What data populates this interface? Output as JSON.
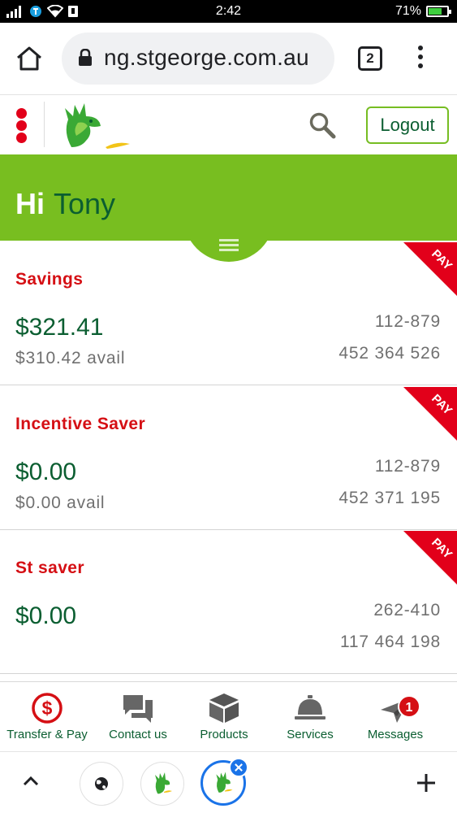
{
  "status_bar": {
    "time": "2:42",
    "battery": "71%",
    "battery_level": 0.71
  },
  "browser": {
    "url": "ng.stgeorge.com.au",
    "tab_count": "2"
  },
  "header": {
    "logout_label": "Logout"
  },
  "greeting": {
    "hi": "Hi",
    "name": "Tony"
  },
  "accounts": [
    {
      "name": "Savings",
      "balance": "$321.41",
      "available": "$310.42 avail",
      "bsb": "112-879",
      "account_number": "452 364 526",
      "ribbon": "PAY"
    },
    {
      "name": "Incentive Saver",
      "balance": "$0.00",
      "available": "$0.00 avail",
      "bsb": "112-879",
      "account_number": "452 371 195",
      "ribbon": "PAY"
    },
    {
      "name": "St saver",
      "balance": "$0.00",
      "available": "",
      "bsb": "262-410",
      "account_number": "117 464 198",
      "ribbon": "PAY"
    }
  ],
  "bottom_nav": [
    {
      "label": "Transfer & Pay",
      "icon": "dollar-circle-icon"
    },
    {
      "label": "Contact us",
      "icon": "chat-bubbles-icon"
    },
    {
      "label": "Products",
      "icon": "box-icon"
    },
    {
      "label": "Services",
      "icon": "service-bell-icon"
    },
    {
      "label": "Messages",
      "icon": "paper-plane-icon",
      "badge": "1"
    }
  ],
  "colors": {
    "brand_green": "#78be20",
    "dark_green": "#0b5e31",
    "brand_red": "#d50f14",
    "chrome_blue": "#1a73e8"
  }
}
